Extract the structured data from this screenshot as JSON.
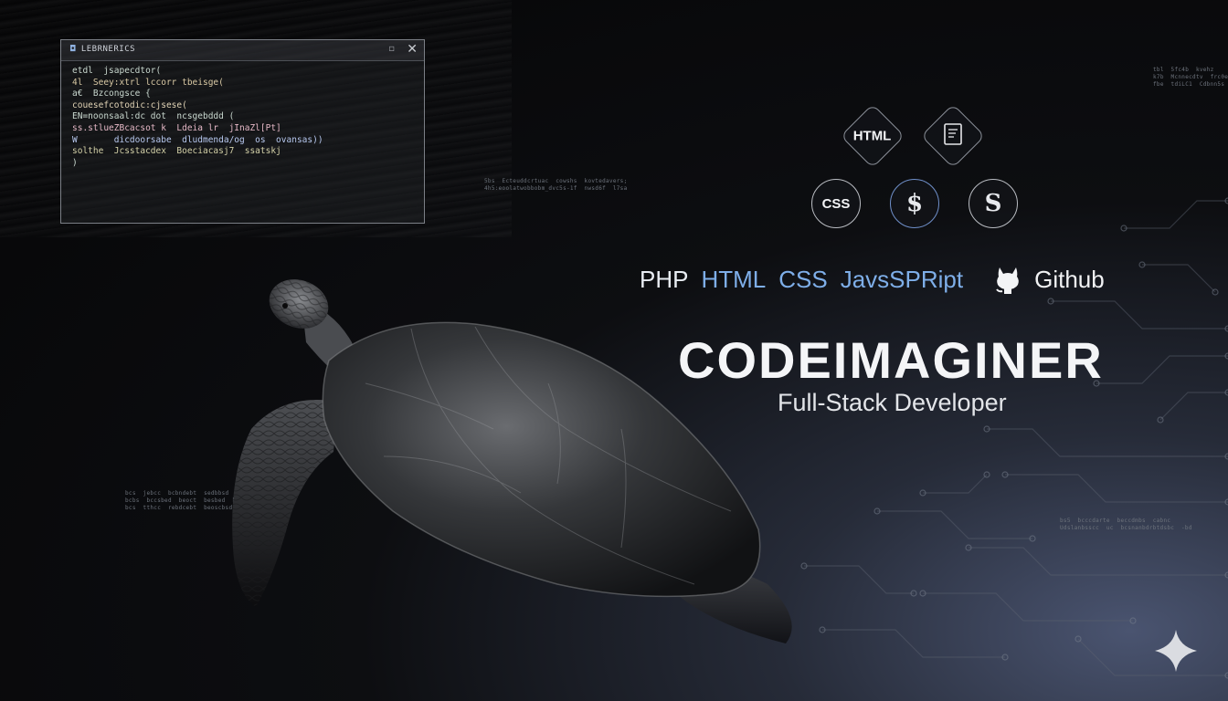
{
  "code_window": {
    "title": "LEBRNERICS",
    "close_label": "✕",
    "minimize_label": "▫",
    "lines": [
      "etdl  jsapecdtor(",
      "4l  Seey:xtrl lccorr tbeisge(",
      "a€  Bzcongsce {",
      "couesefcotodic:cjsese(",
      "EN=noonsaal:dc dot  ncsgebddd (",
      "ss.stlueZBcacsot k  Ldeia lr  jInaZl[Pt]",
      "W       dicdoorsabe  dludmenda/og  os  ovansas))",
      "solthe  Jcsstacdex  Boeciacasj7  ssatskj",
      ")"
    ]
  },
  "background_snippets": [
    "5bs  Ecteuddcrtuac  cowshs  kovtedavers;\n4h5:eoolatwobbobm_dvc5s-1f  nwsd6f  l7sa",
    "tbl  5fc4b  kvehz\nk7b  Mcnnecdtv  frc0e\nfbe  tdiLC1  Cdbnn5s",
    "bcs  jebcc  bcbndebt  sedbbsd  bs.bnbndebt  bs.b.\nbcbs  bccsbed  beoct  besbed  bsbd  cbsr  bs.bn\nbcs  tthcc  rebdcebt  beoscbsd  cbaad-bssb-bs",
    "bs5  bcccdarte  beccdmbs  cabnc\nUdslanbsscc  uc  bcsnanbdrbtdsbc  -bd"
  ],
  "tech_icons": [
    {
      "label": "HTML",
      "icon": "html-badge"
    },
    {
      "label": "",
      "icon": "document-icon"
    },
    {
      "label": "CSS",
      "icon": "css-badge"
    },
    {
      "label": "$",
      "icon": "dollar-script-icon"
    },
    {
      "label": "S",
      "icon": "s-script-icon"
    }
  ],
  "tech_line": {
    "words": [
      "PHP",
      "HTML",
      "CSS",
      "JavsSPRipt"
    ],
    "github_label": "Github",
    "github_icon": "github-cat-icon"
  },
  "brand": {
    "title": "CODEIMAGINER",
    "subtitle": "Full-Stack Developer"
  },
  "colors": {
    "accent_blue": "#7eaee8",
    "text_light": "#f4f5f7",
    "background_dark": "#050506"
  },
  "sparkle_icon": "sparkle-icon"
}
